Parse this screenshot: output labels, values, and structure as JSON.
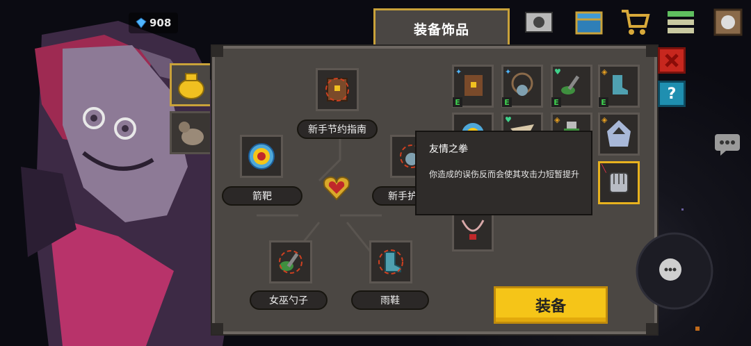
{
  "currency": {
    "gems": "908",
    "icon": "gem-icon"
  },
  "title": "装备饰品",
  "equipped": {
    "top": "新手节约指南",
    "left": "箭靶",
    "right": "新手护身符",
    "bottom_left": "女巫勺子",
    "bottom_right": "雨鞋"
  },
  "tooltip": {
    "title": "友情之拳",
    "description": "你造成的误伤反而会使其攻击力短暂提升"
  },
  "equip_button": "装备",
  "help_label": "?",
  "inventory_tag": "E",
  "colors": {
    "accent": "#f5c518",
    "panel": "#4b4743",
    "close": "#c7271e",
    "help": "#1f8fb0",
    "equipped_tag": "#3fd14f"
  }
}
